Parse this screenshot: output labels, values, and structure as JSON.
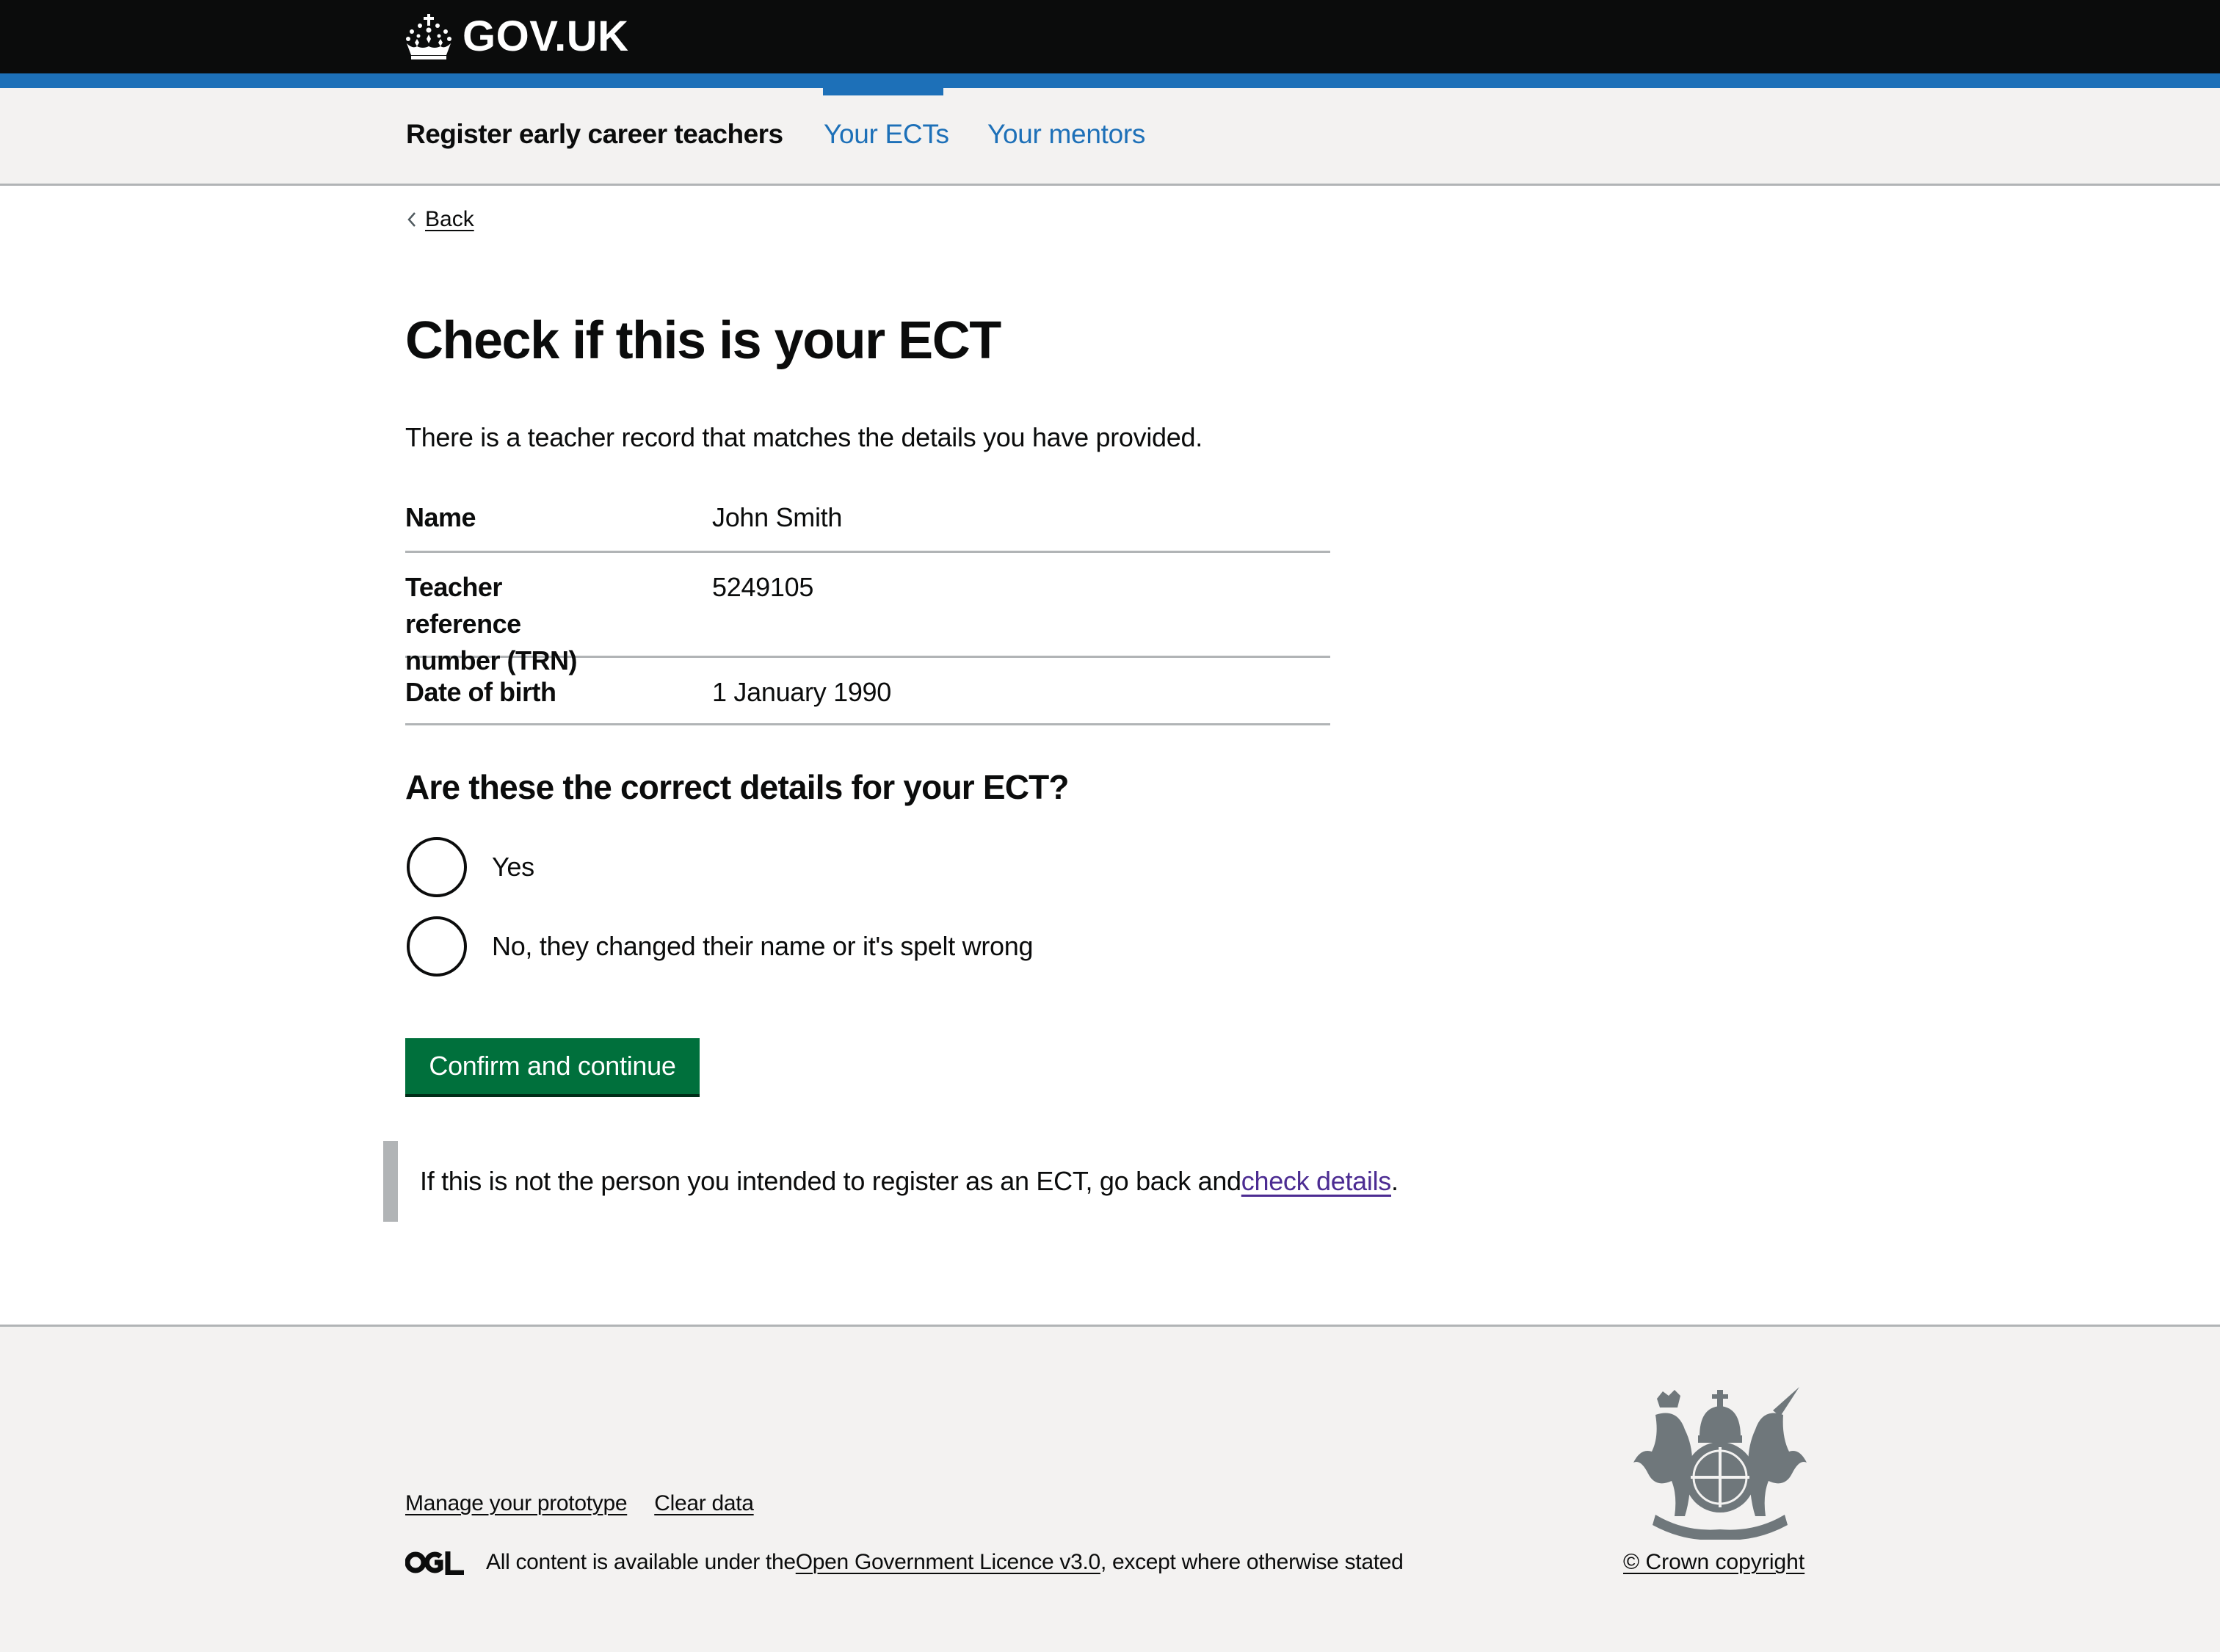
{
  "header": {
    "logo_text": "GOV.UK",
    "logo_icon": "crown-icon"
  },
  "service_nav": {
    "service_name": "Register early career teachers",
    "links": [
      {
        "label": "Your ECTs",
        "active": true
      },
      {
        "label": "Your mentors",
        "active": false
      }
    ]
  },
  "back_link": {
    "label": "Back",
    "icon": "chevron-left-icon"
  },
  "main": {
    "title": "Check if this is your ECT",
    "lead": "There is a teacher record that matches the details you have provided.",
    "summary": [
      {
        "key": "Name",
        "value": "John Smith"
      },
      {
        "key": "Teacher reference number (TRN)",
        "value": "5249105"
      },
      {
        "key": "Date of birth",
        "value": "1 January 1990"
      }
    ],
    "question": "Are these the correct details for your ECT?",
    "options": [
      {
        "label": "Yes",
        "checked": false
      },
      {
        "label": "No, they changed their name or it's spelt wrong",
        "checked": false
      }
    ],
    "submit_label": "Confirm and continue",
    "inset": {
      "text_before": "If this is not the person you intended to register as an ECT, go back and ",
      "link_label": "check details",
      "text_after": "."
    }
  },
  "footer": {
    "links": [
      "Manage your prototype",
      "Clear data"
    ],
    "licence": {
      "logo_text": "OGL",
      "text_before": "All content is available under the ",
      "link_label": "Open Government Licence v3.0",
      "text_after": ", except where otherwise stated"
    },
    "copyright": "© Crown copyright",
    "crest_icon": "royal-coat-of-arms-icon"
  },
  "colors": {
    "header_bg": "#0b0c0c",
    "brand_blue": "#1d70b8",
    "nav_bg": "#f3f2f1",
    "border_grey": "#b1b4b6",
    "button_green": "#00703c",
    "button_shadow": "#002d18",
    "visited_link": "#4c2c92"
  }
}
